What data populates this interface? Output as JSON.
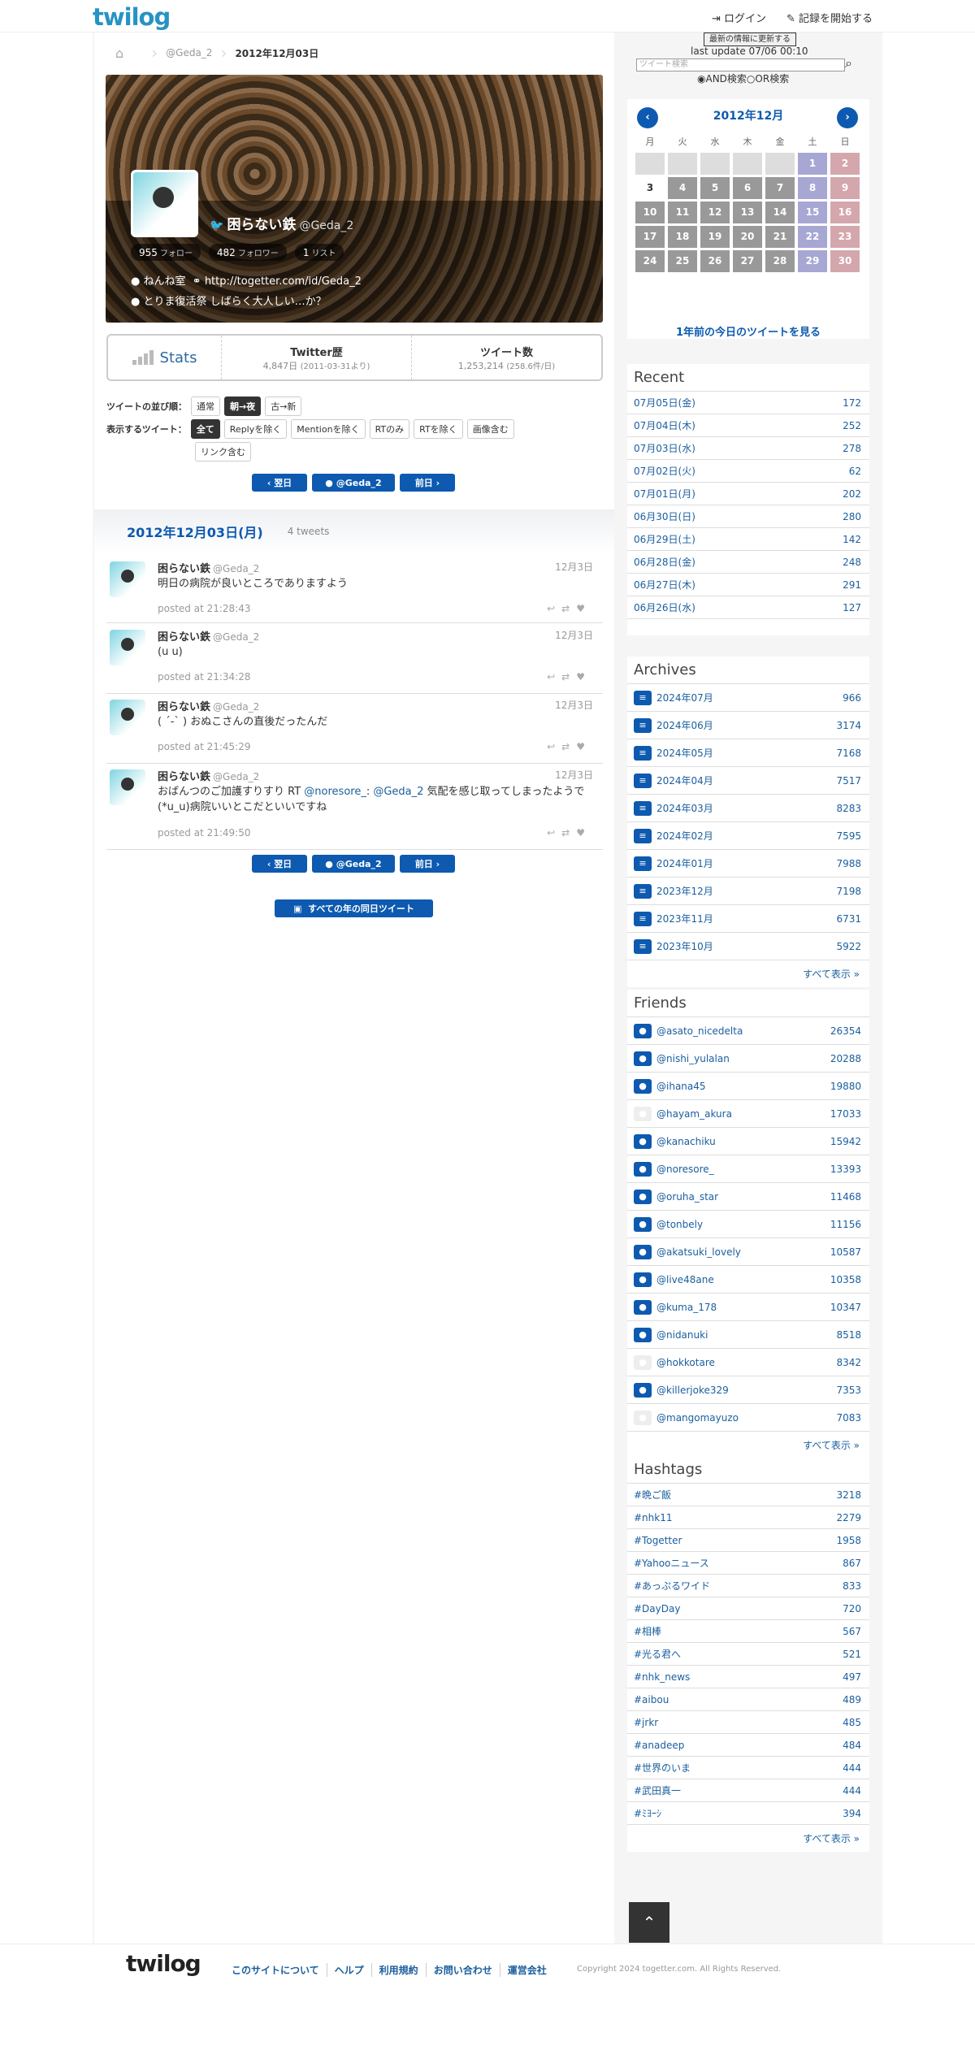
{
  "header": {
    "logo": "twilog",
    "login": "ログイン",
    "start": "記録を開始する"
  },
  "breadcrumb": {
    "user": "@Geda_2",
    "current": "2012年12月03日"
  },
  "profile": {
    "name": "困らない鉄",
    "handle": "@Geda_2",
    "follow_count": "955",
    "follow_label": "フォロー",
    "follower_count": "482",
    "follower_label": "フォロワー",
    "list_count": "1",
    "list_label": "リスト",
    "location": "ねんね室",
    "url": "http://togetter.com/id/Geda_2",
    "bio": "とりま復活祭 しばらく大人しい…か？"
  },
  "stats": {
    "label": "Stats",
    "history_label": "Twitter歴",
    "history_value": "4,847日",
    "history_since": "(2011-03-31より)",
    "tweets_label": "ツイート数",
    "tweets_value": "1,253,214",
    "tweets_rate": "(258.6件/日)"
  },
  "order": {
    "label": "ツイートの並び順：",
    "options": [
      "通常",
      "朝→夜",
      "古→新"
    ],
    "selected": "朝→夜"
  },
  "filter": {
    "label": "表示するツイート：",
    "options": [
      "全て",
      "Replyを除く",
      "Mentionを除く",
      "RTのみ",
      "RTを除く",
      "画像含む",
      "リンク含む"
    ],
    "selected": "全て"
  },
  "nav": {
    "next": "翌日",
    "user": "@Geda_2",
    "prev": "前日"
  },
  "day": {
    "date": "2012年12月03日(月)",
    "count": "4 tweets"
  },
  "tweets": [
    {
      "name": "困らない鉄",
      "handle": "@Geda_2",
      "date": "12月3日",
      "text": "明日の病院が良いところでありますよう",
      "posted": "posted at 21:28:43"
    },
    {
      "name": "困らない鉄",
      "handle": "@Geda_2",
      "date": "12月3日",
      "text": "(u u)",
      "posted": "posted at 21:34:28"
    },
    {
      "name": "困らない鉄",
      "handle": "@Geda_2",
      "date": "12月3日",
      "text": "( ´-` ) おぬこさんの直後だったんだ",
      "posted": "posted at 21:45:29"
    },
    {
      "name": "困らない鉄",
      "handle": "@Geda_2",
      "date": "12月3日",
      "text_pre": "おばんつのご加護すりすり RT ",
      "mention1": "@noresore_",
      "text_mid": ": ",
      "mention2": "@Geda_2",
      "text_post": " 気配を感じ取ってしまったようで(*u_u)病院いいとこだといいですね",
      "posted": "posted at 21:49:50"
    }
  ],
  "all_years": "すべての年の同日ツイート",
  "sidebar": {
    "update_button": "最新の情報に更新する",
    "last_update": "last update 07/06 00:10",
    "search_placeholder": "ツイート検索",
    "and_label": "AND検索",
    "or_label": "OR検索",
    "calendar": {
      "title": "2012年12月",
      "dow": [
        "月",
        "火",
        "水",
        "木",
        "金",
        "土",
        "日"
      ],
      "more": "1年前の今日のツイートを見る"
    },
    "recent": {
      "title": "Recent",
      "items": [
        {
          "label": "07月05日(金)",
          "count": "172"
        },
        {
          "label": "07月04日(木)",
          "count": "252"
        },
        {
          "label": "07月03日(水)",
          "count": "278"
        },
        {
          "label": "07月02日(火)",
          "count": "62"
        },
        {
          "label": "07月01日(月)",
          "count": "202"
        },
        {
          "label": "06月30日(日)",
          "count": "280"
        },
        {
          "label": "06月29日(土)",
          "count": "142"
        },
        {
          "label": "06月28日(金)",
          "count": "248"
        },
        {
          "label": "06月27日(木)",
          "count": "291"
        },
        {
          "label": "06月26日(水)",
          "count": "127"
        }
      ]
    },
    "archives": {
      "title": "Archives",
      "items": [
        {
          "label": "2024年07月",
          "count": "966"
        },
        {
          "label": "2024年06月",
          "count": "3174"
        },
        {
          "label": "2024年05月",
          "count": "7168"
        },
        {
          "label": "2024年04月",
          "count": "7517"
        },
        {
          "label": "2024年03月",
          "count": "8283"
        },
        {
          "label": "2024年02月",
          "count": "7595"
        },
        {
          "label": "2024年01月",
          "count": "7988"
        },
        {
          "label": "2023年12月",
          "count": "7198"
        },
        {
          "label": "2023年11月",
          "count": "6731"
        },
        {
          "label": "2023年10月",
          "count": "5922"
        }
      ],
      "all": "すべて表示 »"
    },
    "friends": {
      "title": "Friends",
      "items": [
        {
          "label": "@asato_nicedelta",
          "count": "26354"
        },
        {
          "label": "@nishi_yulalan",
          "count": "20288"
        },
        {
          "label": "@ihana45",
          "count": "19880"
        },
        {
          "label": "@hayam_akura",
          "count": "17033"
        },
        {
          "label": "@kanachiku",
          "count": "15942"
        },
        {
          "label": "@noresore_",
          "count": "13393"
        },
        {
          "label": "@oruha_star",
          "count": "11468"
        },
        {
          "label": "@tonbely",
          "count": "11156"
        },
        {
          "label": "@akatsuki_lovely",
          "count": "10587"
        },
        {
          "label": "@live48ane",
          "count": "10358"
        },
        {
          "label": "@kuma_178",
          "count": "10347"
        },
        {
          "label": "@nidanuki",
          "count": "8518"
        },
        {
          "label": "@hokkotare",
          "count": "8342"
        },
        {
          "label": "@killerjoke329",
          "count": "7353"
        },
        {
          "label": "@mangomayuzo",
          "count": "7083"
        }
      ],
      "all": "すべて表示 »"
    },
    "hashtags": {
      "title": "Hashtags",
      "items": [
        {
          "label": "#晩ご飯",
          "count": "3218"
        },
        {
          "label": "#nhk11",
          "count": "2279"
        },
        {
          "label": "#Togetter",
          "count": "1958"
        },
        {
          "label": "#Yahooニュース",
          "count": "867"
        },
        {
          "label": "#あっぷるワイド",
          "count": "833"
        },
        {
          "label": "#DayDay",
          "count": "720"
        },
        {
          "label": "#相棒",
          "count": "567"
        },
        {
          "label": "#光る君へ",
          "count": "521"
        },
        {
          "label": "#nhk_news",
          "count": "497"
        },
        {
          "label": "#aibou",
          "count": "489"
        },
        {
          "label": "#jrkr",
          "count": "485"
        },
        {
          "label": "#anadeep",
          "count": "484"
        },
        {
          "label": "#世界のいま",
          "count": "444"
        },
        {
          "label": "#武田真一",
          "count": "444"
        },
        {
          "label": "#ﾐﾖｰｼ",
          "count": "394"
        }
      ],
      "all": "すべて表示 »"
    }
  },
  "footer": {
    "logo": "twilog",
    "links": [
      "このサイトについて",
      "ヘルプ",
      "利用規約",
      "お問い合わせ",
      "運営会社"
    ],
    "copyright": "Copyright 2024 togetter.com. All Rights Reserved."
  }
}
